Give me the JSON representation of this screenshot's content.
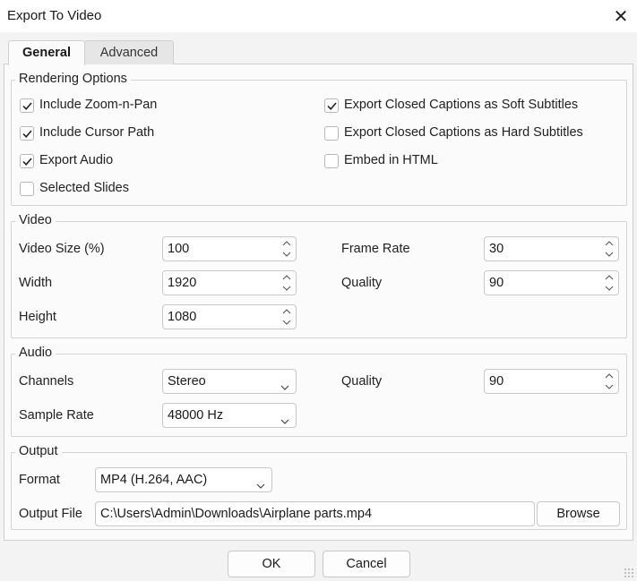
{
  "window": {
    "title": "Export To Video"
  },
  "tabs": [
    {
      "label": "General"
    },
    {
      "label": "Advanced"
    }
  ],
  "rendering": {
    "legend": "Rendering Options",
    "options": [
      {
        "label": "Include Zoom-n-Pan",
        "checked": true
      },
      {
        "label": "Include Cursor Path",
        "checked": true
      },
      {
        "label": "Export Audio",
        "checked": true
      },
      {
        "label": "Selected Slides",
        "checked": false
      },
      {
        "label": "Export Closed Captions as Soft Subtitles",
        "checked": true
      },
      {
        "label": "Export Closed Captions as Hard Subtitles",
        "checked": false
      },
      {
        "label": "Embed in HTML",
        "checked": false
      }
    ]
  },
  "video": {
    "legend": "Video",
    "video_size_label": "Video Size (%)",
    "video_size": "100",
    "width_label": "Width",
    "width": "1920",
    "height_label": "Height",
    "height": "1080",
    "frame_rate_label": "Frame Rate",
    "frame_rate": "30",
    "quality_label": "Quality",
    "quality": "90"
  },
  "audio": {
    "legend": "Audio",
    "channels_label": "Channels",
    "channels": "Stereo",
    "sample_rate_label": "Sample Rate",
    "sample_rate": "48000 Hz",
    "quality_label": "Quality",
    "quality": "90"
  },
  "output": {
    "legend": "Output",
    "format_label": "Format",
    "format": "MP4 (H.264, AAC)",
    "file_label": "Output File",
    "file": "C:\\Users\\Admin\\Downloads\\Airplane parts.mp4",
    "browse_label": "Browse"
  },
  "buttons": {
    "ok": "OK",
    "cancel": "Cancel"
  }
}
